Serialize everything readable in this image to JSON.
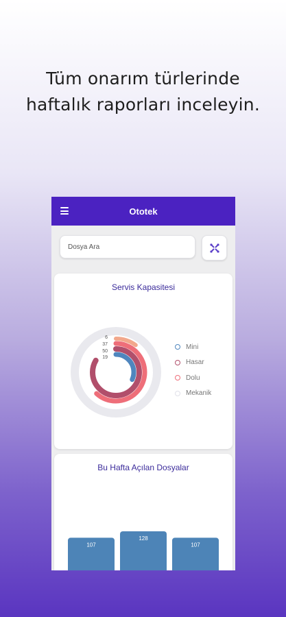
{
  "headline": {
    "line1": "Tüm onarım türlerinde",
    "line2": "haftalık raporları inceleyin."
  },
  "appbar": {
    "title": "Ototek"
  },
  "search": {
    "placeholder": "Dosya Ara"
  },
  "capacity_card": {
    "title": "Servis Kapasitesi",
    "legend": [
      {
        "label": "Mini",
        "color": "#4f86be"
      },
      {
        "label": "Hasar",
        "color": "#b14f6b"
      },
      {
        "label": "Dolu",
        "color": "#ee6e79"
      },
      {
        "label": "Mekanik",
        "color": "#e8e8ee"
      }
    ]
  },
  "weekly_card": {
    "title": "Bu Hafta Açılan Dosyalar"
  },
  "chart_data": [
    {
      "type": "radial-bar",
      "title": "Servis Kapasitesi",
      "series": [
        {
          "name": "Mini",
          "value": 19,
          "color": "#4f86be"
        },
        {
          "name": "Hasar",
          "value": 50,
          "color": "#b14f6b"
        },
        {
          "name": "Dolu",
          "value": 37,
          "color": "#ee6e79"
        },
        {
          "name": "Mekanik",
          "value": 6,
          "color": "#f2a88c"
        }
      ],
      "ring_labels": [
        "6",
        "37",
        "50",
        "19"
      ]
    },
    {
      "type": "bar",
      "title": "Bu Hafta Açılan Dosyalar",
      "values": [
        107,
        128,
        107
      ],
      "color": "#4d84b7"
    }
  ]
}
